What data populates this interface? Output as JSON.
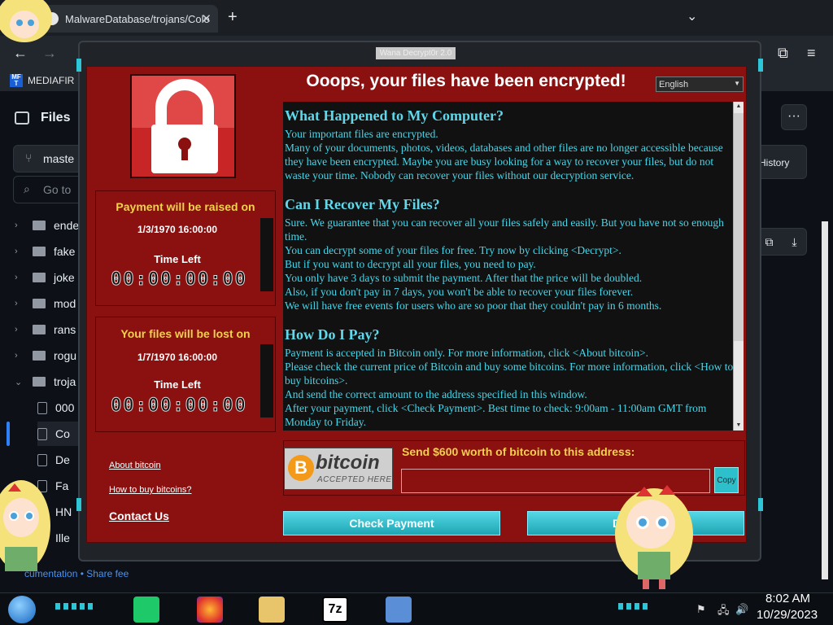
{
  "browser": {
    "tab_title": "MalwareDatabase/trojans/Colo",
    "tab_close": "✕",
    "new_tab": "+",
    "bookmark_label": "MEDIAFIR",
    "bookmark_icon_text": "MF T"
  },
  "github": {
    "files_heading": "Files",
    "branch": "maste",
    "goto_placeholder": "Go to",
    "tree": [
      {
        "label": "ende",
        "kind": "folder",
        "expanded": false
      },
      {
        "label": "fake",
        "kind": "folder",
        "expanded": false
      },
      {
        "label": "joke",
        "kind": "folder",
        "expanded": false
      },
      {
        "label": "mod",
        "kind": "folder",
        "expanded": false
      },
      {
        "label": "rans",
        "kind": "folder",
        "expanded": false
      },
      {
        "label": "rogu",
        "kind": "folder",
        "expanded": false
      },
      {
        "label": "troja",
        "kind": "folder",
        "expanded": true
      },
      {
        "label": "000",
        "kind": "file"
      },
      {
        "label": "Co",
        "kind": "file",
        "selected": true
      },
      {
        "label": "De",
        "kind": "file"
      },
      {
        "label": "Fa",
        "kind": "file"
      },
      {
        "label": "HN",
        "kind": "file"
      },
      {
        "label": "Ille",
        "kind": "file"
      }
    ],
    "footer_links": "cumentation • Share fee",
    "history_label": "History"
  },
  "wannacry": {
    "window_title": "Wana Decrypt0r 2.0",
    "heading": "Ooops, your files have been encrypted!",
    "language": "English",
    "raise_box": {
      "title": "Payment will be raised on",
      "date": "1/3/1970 16:00:00",
      "time_left_label": "Time Left",
      "timer": "00:00:00:00"
    },
    "lost_box": {
      "title": "Your files will be lost on",
      "date": "1/7/1970 16:00:00",
      "time_left_label": "Time Left",
      "timer": "00:00:00:00"
    },
    "links": {
      "about_bitcoin": "About bitcoin",
      "how_to_buy": "How to buy bitcoins?",
      "contact_us": "Contact Us"
    },
    "sections": [
      {
        "heading": "What Happened to My Computer?",
        "lines": [
          "Your important files are encrypted.",
          "Many of your documents, photos, videos, databases and other files are no longer accessible because they have been encrypted. Maybe you are busy looking for a way to recover your files, but do not waste your time. Nobody can recover your files without our decryption service."
        ]
      },
      {
        "heading": "Can I Recover My Files?",
        "lines": [
          "Sure. We guarantee that you can recover all your files safely and easily. But you have not so enough time.",
          "You can decrypt some of your files for free. Try now by clicking <Decrypt>.",
          "But if you want to decrypt all your files, you need to pay.",
          "You only have 3 days to submit the payment. After that the price will be doubled.",
          "Also, if you don't pay in 7 days, you won't be able to recover your files forever.",
          "We will have free events for users who are so poor that they couldn't pay in 6 months."
        ]
      },
      {
        "heading": "How Do I Pay?",
        "lines": [
          "Payment is accepted in Bitcoin only. For more information, click <About bitcoin>.",
          "Please check the current price of Bitcoin and buy some bitcoins. For more information, click <How to buy bitcoins>.",
          "And send the correct amount to the address specified in this window.",
          "After your payment, click <Check Payment>. Best time to check: 9:00am - 11:00am GMT from Monday to Friday."
        ]
      }
    ],
    "bitcoin_logo": {
      "word": "bitcoin",
      "accepted": "ACCEPTED HERE",
      "coin": "B"
    },
    "send_label": "Send $600 worth of bitcoin to this address:",
    "address_value": "",
    "copy_label": "Copy",
    "check_payment": "Check Payment",
    "decrypt": "D"
  },
  "taskbar": {
    "time": "8:02 AM",
    "date": "10/29/2023",
    "apps": [
      "notes-app",
      "firefox",
      "file-explorer",
      "7zip",
      "handshake-app"
    ],
    "app_7z_text": "7z"
  },
  "colors": {
    "wc_red": "#8b1010",
    "wc_yellow": "#f3d14b",
    "wc_cyan_text": "#46d7ea",
    "button_cyan": "#2dbfcc"
  }
}
